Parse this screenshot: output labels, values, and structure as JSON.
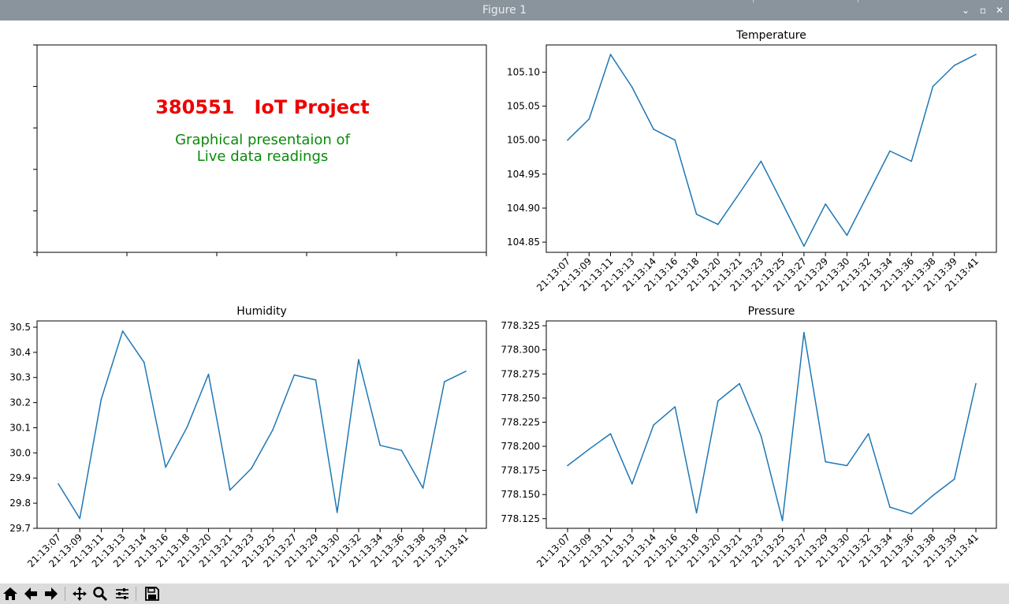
{
  "window": {
    "title": "Figure 1",
    "controls": {
      "minimize_glyph": "⌄",
      "maximize_glyph": "▫",
      "close_glyph": "✕"
    }
  },
  "toolbar": {
    "buttons": [
      {
        "name": "home-button",
        "icon": "home-icon"
      },
      {
        "name": "back-button",
        "icon": "arrow-left-icon"
      },
      {
        "name": "forward-button",
        "icon": "arrow-right-icon"
      },
      {
        "name": "pan-button",
        "icon": "move-icon"
      },
      {
        "name": "zoom-button",
        "icon": "magnifier-icon"
      },
      {
        "name": "configure-subplots-button",
        "icon": "sliders-icon"
      },
      {
        "name": "save-button",
        "icon": "floppy-disk-icon"
      }
    ]
  },
  "colors": {
    "line": "#1f77b4",
    "title_red": "#ee0000",
    "subtitle_green": "#0a8a0a"
  },
  "banner": {
    "title": "380551   IoT Project",
    "subtitle_line1": "Graphical presentaion of",
    "subtitle_line2": "Live data readings"
  },
  "chart_data": [
    {
      "type": "line",
      "title": "Temperature",
      "x": [
        "21:13:07",
        "21:13:09",
        "21:13:11",
        "21:13:13",
        "21:13:14",
        "21:13:16",
        "21:13:18",
        "21:13:20",
        "21:13:21",
        "21:13:23",
        "21:13:25",
        "21:13:27",
        "21:13:29",
        "21:13:30",
        "21:13:32",
        "21:13:34",
        "21:13:36",
        "21:13:38",
        "21:13:39",
        "21:13:41"
      ],
      "values": [
        105.0,
        105.031,
        105.126,
        105.078,
        105.016,
        105.0,
        104.891,
        104.876,
        104.922,
        104.969,
        104.907,
        104.844,
        104.906,
        104.86,
        104.922,
        104.984,
        104.969,
        105.079,
        105.11,
        105.126
      ],
      "ylim": [
        104.835,
        105.14
      ],
      "yticks": [
        104.85,
        104.9,
        104.95,
        105.0,
        105.05,
        105.1
      ],
      "ytick_decimals": 2,
      "grid": false
    },
    {
      "type": "line",
      "title": "Humidity",
      "x": [
        "21:13:07",
        "21:13:09",
        "21:13:11",
        "21:13:13",
        "21:13:14",
        "21:13:16",
        "21:13:18",
        "21:13:20",
        "21:13:21",
        "21:13:23",
        "21:13:25",
        "21:13:27",
        "21:13:29",
        "21:13:30",
        "21:13:32",
        "21:13:34",
        "21:13:36",
        "21:13:38",
        "21:13:39",
        "21:13:41"
      ],
      "values": [
        29.877,
        29.739,
        30.213,
        30.485,
        30.36,
        29.943,
        30.102,
        30.313,
        29.852,
        29.938,
        30.092,
        30.31,
        30.29,
        29.763,
        30.371,
        30.03,
        30.01,
        29.86,
        30.283,
        30.325
      ],
      "ylim": [
        29.7,
        30.525
      ],
      "yticks": [
        29.7,
        29.8,
        29.9,
        30.0,
        30.1,
        30.2,
        30.3,
        30.4,
        30.5
      ],
      "ytick_decimals": 1,
      "grid": false
    },
    {
      "type": "line",
      "title": "Pressure",
      "x": [
        "21:13:07",
        "21:13:09",
        "21:13:11",
        "21:13:13",
        "21:13:14",
        "21:13:16",
        "21:13:18",
        "21:13:20",
        "21:13:21",
        "21:13:23",
        "21:13:25",
        "21:13:27",
        "21:13:29",
        "21:13:30",
        "21:13:32",
        "21:13:34",
        "21:13:36",
        "21:13:38",
        "21:13:39",
        "21:13:41"
      ],
      "values": [
        778.18,
        778.197,
        778.213,
        778.161,
        778.222,
        778.241,
        778.131,
        778.247,
        778.265,
        778.211,
        778.123,
        778.318,
        778.184,
        778.18,
        778.213,
        778.137,
        778.13,
        778.149,
        778.166,
        778.265
      ],
      "ylim": [
        778.115,
        778.33
      ],
      "yticks": [
        778.125,
        778.15,
        778.175,
        778.2,
        778.225,
        778.25,
        778.275,
        778.3,
        778.325
      ],
      "ytick_decimals": 3,
      "grid": false
    }
  ]
}
